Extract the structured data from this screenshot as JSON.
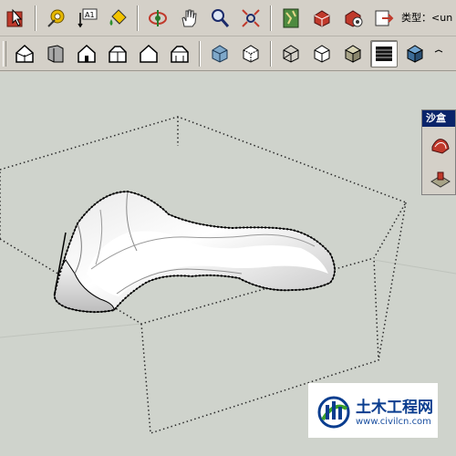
{
  "toolbar1": {
    "buttons": [
      {
        "icon": "select-icon"
      },
      {
        "icon": "tape-measure-icon"
      },
      {
        "icon": "text-label-icon",
        "text": "A1"
      },
      {
        "icon": "paint-bucket-icon"
      },
      {
        "icon": "orbit-icon"
      },
      {
        "icon": "pan-hand-icon"
      },
      {
        "icon": "zoom-icon"
      },
      {
        "icon": "zoom-extents-icon"
      },
      {
        "icon": "map-icon"
      },
      {
        "icon": "component-red-icon"
      },
      {
        "icon": "materials-icon"
      },
      {
        "icon": "export-icon"
      }
    ],
    "type_label": "类型：<un"
  },
  "toolbar2": {
    "views": [
      "iso-view-icon",
      "top-view-icon",
      "front-view-icon",
      "right-view-icon",
      "back-view-icon",
      "left-view-icon"
    ],
    "styles": [
      "xray-style-icon",
      "back-edges-style-icon",
      "wireframe-style-icon",
      "hidden-line-style-icon",
      "shaded-style-icon",
      "shaded-textures-style-icon",
      "monochrome-style-icon"
    ],
    "active_style": "shaded-textures-style-icon"
  },
  "sandbox": {
    "title": "沙盒",
    "tools": [
      "sandbox-from-contours-icon",
      "sandbox-stamp-icon"
    ]
  },
  "watermark": {
    "title": "土木工程网",
    "url": "www.civilcn.com"
  },
  "colors": {
    "background": "#d4d0c8",
    "viewport": "#cfd3cc",
    "panel_title": "#0a246a",
    "watermark_blue": "#0a3d8f"
  }
}
